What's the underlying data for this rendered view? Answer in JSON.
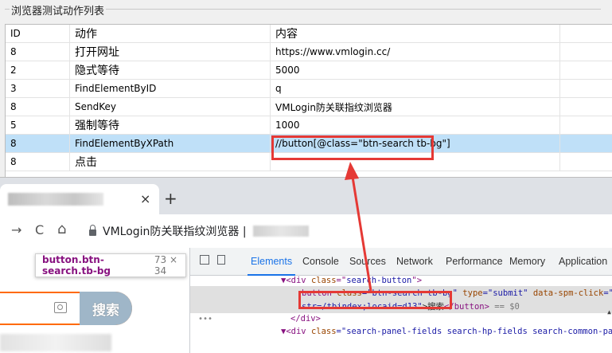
{
  "panel": {
    "title": "浏览器测试动作列表"
  },
  "grid": {
    "headers": [
      "ID",
      "动作",
      "内容"
    ],
    "rows": [
      {
        "id": "8",
        "action": "打开网址",
        "value": "https://www.vmlogin.cc/"
      },
      {
        "id": "2",
        "action": "隐式等待",
        "value": "5000"
      },
      {
        "id": "3",
        "action": "FindElementByID",
        "value": "q"
      },
      {
        "id": "8",
        "action": "SendKey",
        "value": "VMLogin防关联指纹浏览器"
      },
      {
        "id": "5",
        "action": "强制等待",
        "value": "1000"
      },
      {
        "id": "8",
        "action": "FindElementByXPath",
        "value": "//button[@class=\"btn-search tb-bg\"]"
      },
      {
        "id": "8",
        "action": "点击",
        "value": ""
      }
    ]
  },
  "browser": {
    "tab_close": "×",
    "new_tab": "+",
    "nav": {
      "back": "→",
      "reload": "C",
      "home": "⌂"
    },
    "address": "VMLogin防关联指纹浏览器 |",
    "tooltip": {
      "selector": "button.btn-search.tb-bg",
      "size": "73 × 34"
    },
    "search_button_label": "搜索"
  },
  "devtools": {
    "tabs": [
      "Elements",
      "Console",
      "Sources",
      "Network",
      "Performance",
      "Memory",
      "Application"
    ],
    "active_tab": "Elements",
    "code": {
      "line1_tag_open": "▼<div ",
      "line1_attr": "class",
      "line1_eq": "=\"",
      "line1_val": "search-button",
      "line1_close": "\">",
      "line2_tag": "button ",
      "line2_attr1": "class",
      "line2_val1": "=\"btn-search tb-bg\"",
      "line2_attr2": " type",
      "line2_val2": "=\"submit\"",
      "line2_attr3": " data-spm-click",
      "line2_val3": "=\"go",
      "line3_val": "str=/tbindex;locaid=d13\"",
      "line3_text": ">搜索",
      "line3_close": "</button>",
      "line3_eq": " == $0",
      "line4": "</div>",
      "line5_tag": "▼<div ",
      "line5_attr": "class",
      "line5_val": "=\"search-panel-fields search-hp-fields search-common-pan"
    }
  },
  "colors": {
    "highlight_red": "#e53935",
    "selected_row": "#bfe0f8",
    "devtools_active": "#1a73e8"
  }
}
